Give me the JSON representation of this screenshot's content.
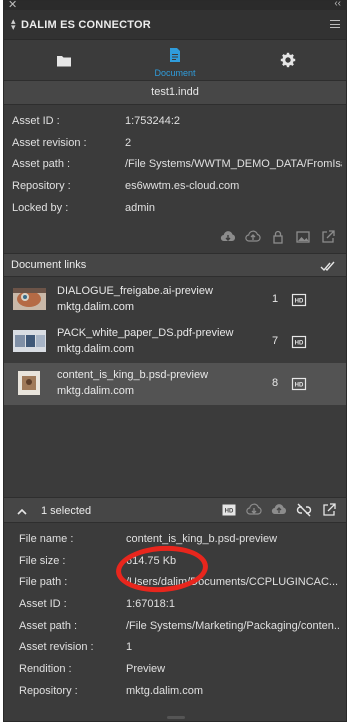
{
  "window": {
    "close_glyph": "✕",
    "collapse_glyph": "‹‹"
  },
  "header": {
    "title": "DALIM ES CONNECTOR"
  },
  "tabs": [
    {
      "icon": "folder-icon",
      "label": ""
    },
    {
      "icon": "document-icon",
      "label": "Document"
    },
    {
      "icon": "gear-icon",
      "label": ""
    }
  ],
  "document": {
    "file_name": "test1.indd",
    "properties": [
      {
        "key": "Asset ID :",
        "value": "1:753244:2"
      },
      {
        "key": "Asset revision :",
        "value": "2"
      },
      {
        "key": "Asset path :",
        "value": "/File Systems/WWTM_DEMO_DATA/FromIsa..."
      },
      {
        "key": "Repository :",
        "value": "es6wwtm.es-cloud.com"
      },
      {
        "key": "Locked by :",
        "value": "admin"
      }
    ],
    "actions": [
      "cloud-download-icon",
      "cloud-upload-icon",
      "lock-icon",
      "preview-image-icon",
      "open-external-icon"
    ]
  },
  "links_section": {
    "title": "Document links",
    "links": [
      {
        "name": "DIALOGUE_freigabe.ai-preview",
        "host": "mktg.dalim.com",
        "count": "1",
        "badge": "HD",
        "selected": false
      },
      {
        "name": "PACK_white_paper_DS.pdf-preview",
        "host": "mktg.dalim.com",
        "count": "7",
        "badge": "HD",
        "selected": false
      },
      {
        "name": "content_is_king_b.psd-preview",
        "host": "mktg.dalim.com",
        "count": "8",
        "badge": "HD",
        "selected": true
      }
    ]
  },
  "selection": {
    "label": "1 selected",
    "actions": [
      "hd-badge-icon",
      "cloud-download-icon",
      "cloud-upload-icon",
      "unlink-icon",
      "open-external-icon"
    ],
    "details": [
      {
        "key": "File name :",
        "value": "content_is_king_b.psd-preview"
      },
      {
        "key": "File size :",
        "value": "614.75 Kb"
      },
      {
        "key": "File path :",
        "value": "/Users/dalim/Documents/CCPLUGINCAC..."
      },
      {
        "key": "Asset ID :",
        "value": "1:67018:1"
      },
      {
        "key": "Asset path :",
        "value": "/File Systems/Marketing/Packaging/conten..."
      },
      {
        "key": "Asset revision :",
        "value": "1"
      },
      {
        "key": "Rendition :",
        "value": "Preview"
      },
      {
        "key": "Repository :",
        "value": "mktg.dalim.com"
      }
    ]
  },
  "colors": {
    "accent": "#2f9cdb",
    "panel": "#3b3b3b",
    "highlight_ring": "#e8261d"
  }
}
